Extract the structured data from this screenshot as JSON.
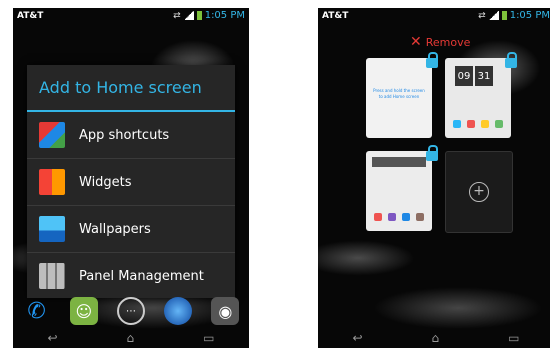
{
  "left_screen": {
    "status": {
      "carrier": "AT&T",
      "time": "1:05 PM"
    },
    "dialog": {
      "title": "Add to Home screen",
      "options": [
        {
          "label": "App shortcuts",
          "icon": "app-shortcuts-icon"
        },
        {
          "label": "Widgets",
          "icon": "widgets-icon"
        },
        {
          "label": "Wallpapers",
          "icon": "wallpapers-icon"
        },
        {
          "label": "Panel Management",
          "icon": "panel-management-icon"
        }
      ]
    },
    "dock": {
      "icons": [
        "phone-icon",
        "messaging-icon",
        "apps-icon",
        "browser-icon",
        "camera-icon"
      ]
    }
  },
  "right_screen": {
    "status": {
      "carrier": "AT&T",
      "time": "1:05 PM"
    },
    "remove_label": "Remove",
    "panels": [
      {
        "name": "panel-1"
      },
      {
        "name": "panel-2",
        "clock": [
          "09",
          "31"
        ]
      },
      {
        "name": "panel-3"
      },
      {
        "name": "panel-add"
      }
    ],
    "panel_text": "Press and hold the screen to add Home screen"
  },
  "colors": {
    "accent": "#33b5e5",
    "remove": "#e53935",
    "background": "#070707"
  }
}
